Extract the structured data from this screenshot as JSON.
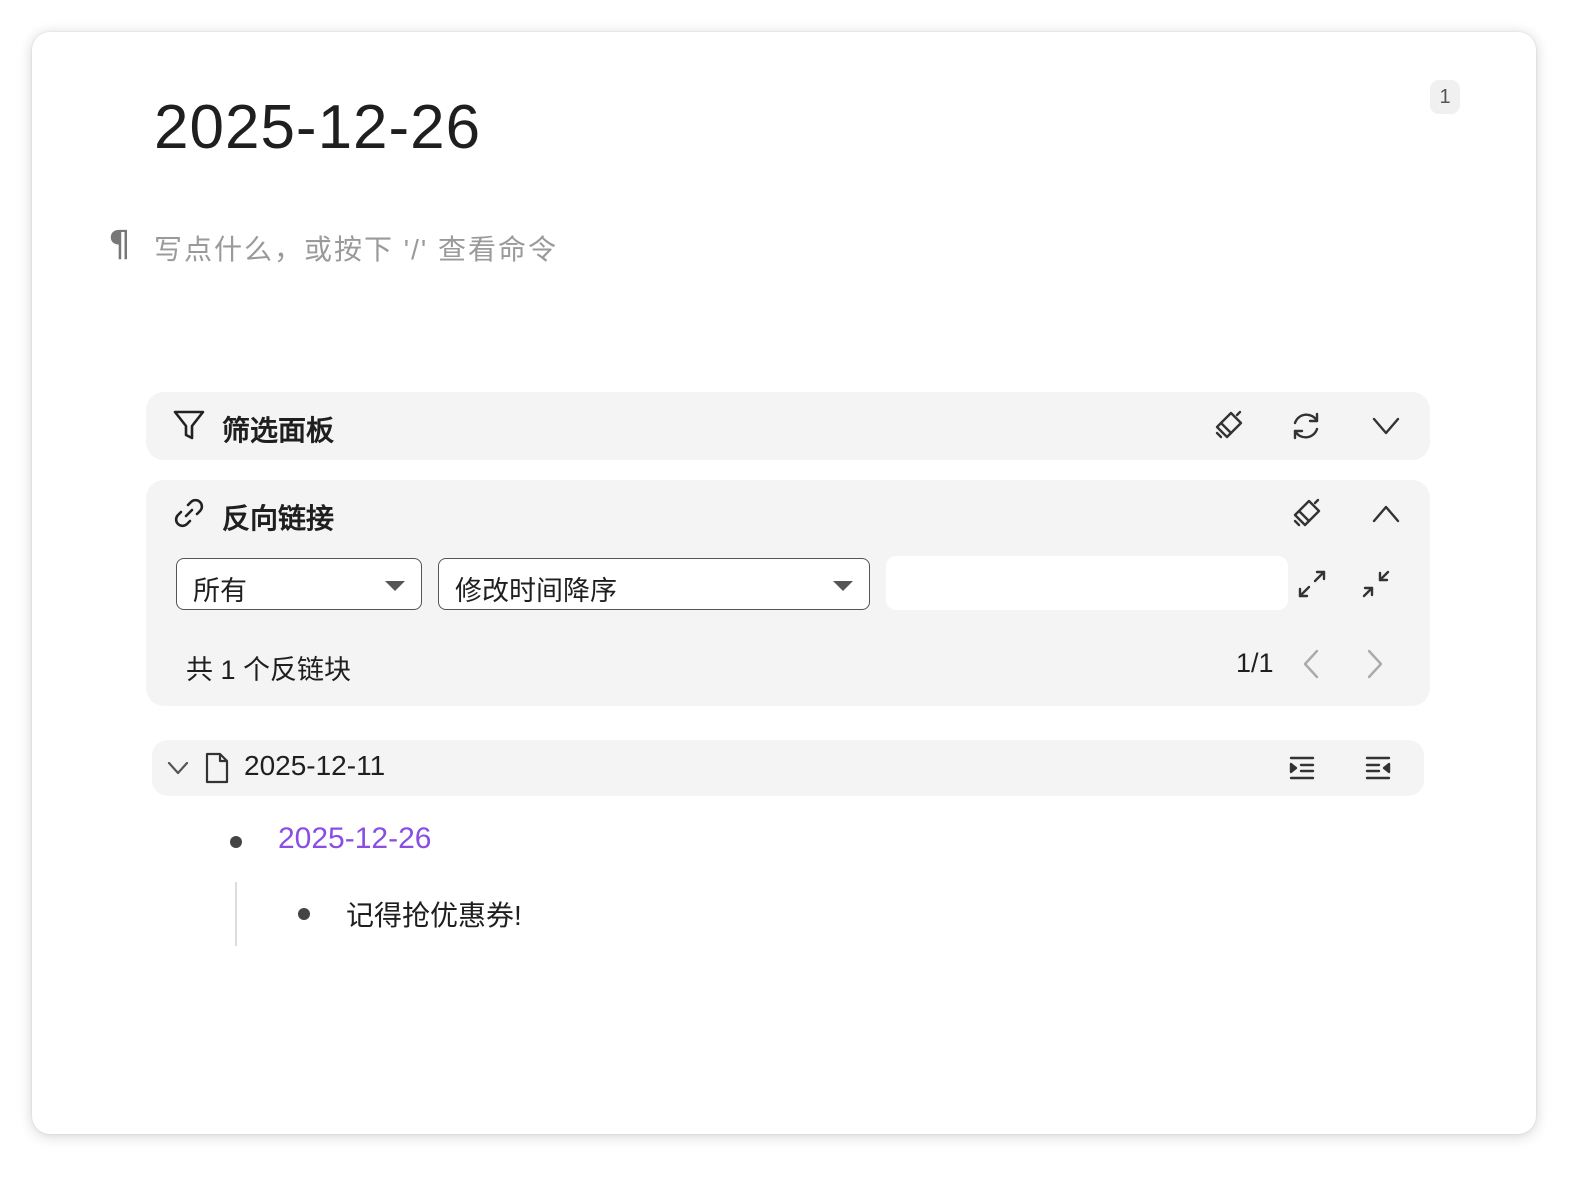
{
  "page": {
    "title": "2025-12-26",
    "badge_count": "1",
    "placeholder": "写点什么，或按下 '/' 查看命令"
  },
  "filter_panel": {
    "title": "筛选面板",
    "icons": [
      "filter-icon",
      "clear-icon",
      "refresh-icon",
      "chevron-down-icon"
    ]
  },
  "backlinks_panel": {
    "title": "反向链接",
    "scope_select": {
      "value": "所有"
    },
    "sort_select": {
      "value": "修改时间降序"
    },
    "search": {
      "value": "",
      "placeholder": ""
    },
    "count_text": "共 1 个反链块",
    "pagination": "1/1",
    "icons": [
      "link-icon",
      "clear-icon",
      "chevron-up-icon",
      "expand-icon",
      "collapse-icon",
      "prev-icon",
      "next-icon"
    ]
  },
  "results": [
    {
      "doc_title": "2025-12-11",
      "items": [
        {
          "text": "2025-12-26",
          "is_link": true
        },
        {
          "text": "记得抢优惠券!",
          "is_link": false
        }
      ]
    }
  ],
  "colors": {
    "panel_bg": "#f4f4f4",
    "link": "#8a4ee3",
    "text": "#1f1f1f",
    "placeholder": "#9a9a9a"
  }
}
